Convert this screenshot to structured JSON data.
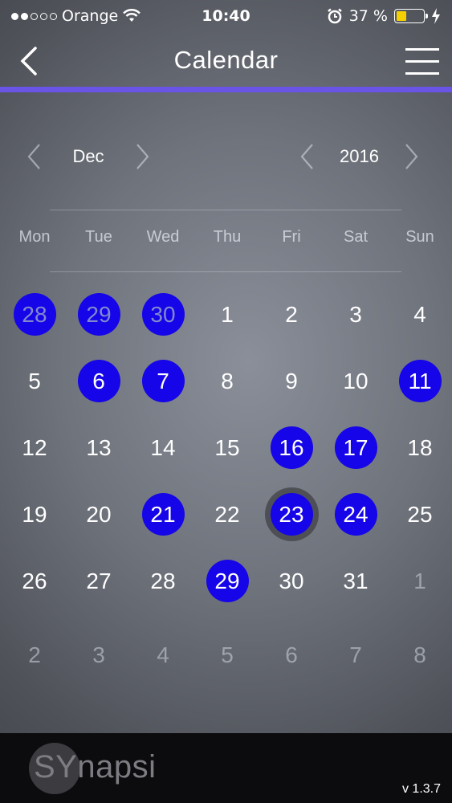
{
  "status_bar": {
    "carrier": "Orange",
    "time": "10:40",
    "battery": "37 %",
    "battery_level": 0.37,
    "icons": [
      "signal-dots",
      "wifi-icon",
      "alarm-icon",
      "battery-icon",
      "charging-bolt-icon"
    ]
  },
  "nav": {
    "title": "Calendar",
    "back_icon": "chevron-left-icon",
    "menu_icon": "hamburger-menu-icon"
  },
  "selector": {
    "month": "Dec",
    "year": "2016"
  },
  "weekdays": [
    "Mon",
    "Tue",
    "Wed",
    "Thu",
    "Fri",
    "Sat",
    "Sun"
  ],
  "weeks": [
    [
      {
        "d": "28",
        "other": true,
        "marked": true
      },
      {
        "d": "29",
        "other": true,
        "marked": true
      },
      {
        "d": "30",
        "other": true,
        "marked": true
      },
      {
        "d": "1"
      },
      {
        "d": "2"
      },
      {
        "d": "3"
      },
      {
        "d": "4"
      }
    ],
    [
      {
        "d": "5"
      },
      {
        "d": "6",
        "marked": true
      },
      {
        "d": "7",
        "marked": true
      },
      {
        "d": "8"
      },
      {
        "d": "9"
      },
      {
        "d": "10"
      },
      {
        "d": "11",
        "marked": true
      }
    ],
    [
      {
        "d": "12"
      },
      {
        "d": "13"
      },
      {
        "d": "14"
      },
      {
        "d": "15"
      },
      {
        "d": "16",
        "marked": true
      },
      {
        "d": "17",
        "marked": true
      },
      {
        "d": "18"
      }
    ],
    [
      {
        "d": "19"
      },
      {
        "d": "20"
      },
      {
        "d": "21",
        "marked": true
      },
      {
        "d": "22"
      },
      {
        "d": "23",
        "marked": true,
        "today": true
      },
      {
        "d": "24",
        "marked": true
      },
      {
        "d": "25"
      }
    ],
    [
      {
        "d": "26"
      },
      {
        "d": "27"
      },
      {
        "d": "28"
      },
      {
        "d": "29",
        "marked": true
      },
      {
        "d": "30"
      },
      {
        "d": "31"
      },
      {
        "d": "1",
        "other": true
      }
    ],
    [
      {
        "d": "2",
        "other": true
      },
      {
        "d": "3",
        "other": true
      },
      {
        "d": "4",
        "other": true
      },
      {
        "d": "5",
        "other": true
      },
      {
        "d": "6",
        "other": true
      },
      {
        "d": "7",
        "other": true
      },
      {
        "d": "8",
        "other": true
      }
    ]
  ],
  "footer": {
    "logo": "SYnapsi",
    "version": "v 1.3.7"
  },
  "colors": {
    "accent_line": "#6a54e6",
    "marked_day": "#1505e8",
    "battery_fill": "#f5d000",
    "footer_bg": "#0c0c0e"
  }
}
